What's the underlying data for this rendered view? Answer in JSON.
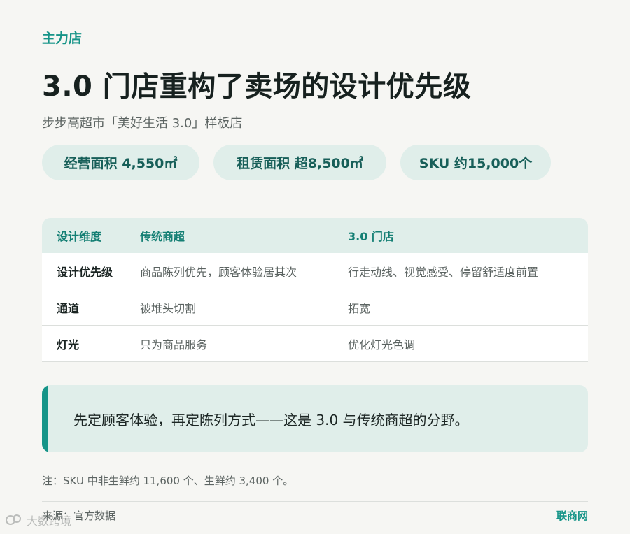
{
  "header": {
    "kicker": "主力店",
    "title": "3.0 门店重构了卖场的设计优先级",
    "subtitle": "步步高超市「美好生活 3.0」样板店"
  },
  "stats": [
    {
      "label": "经营面积 4,550㎡"
    },
    {
      "label": "租赁面积 超8,500㎡"
    },
    {
      "label": "SKU 约15,000个"
    }
  ],
  "table": {
    "headers": [
      "设计维度",
      "传统商超",
      "3.0 门店"
    ],
    "rows": [
      [
        "设计优先级",
        "商品陈列优先，顾客体验居其次",
        "行走动线、视觉感受、停留舒适度前置"
      ],
      [
        "通道",
        "被堆头切割",
        "拓宽"
      ],
      [
        "灯光",
        "只为商品服务",
        "优化灯光色调"
      ]
    ]
  },
  "callout": {
    "text": "先定顾客体验，再定陈列方式——这是 3.0 与传统商超的分野。"
  },
  "footer": {
    "note": "注：SKU 中非生鲜约 11,600 个、生鲜约 3,400 个。",
    "source": "来源：官方数据",
    "brand": "联商网"
  },
  "watermark": {
    "text": "大数跨境"
  },
  "colors": {
    "accent": "#169488",
    "accent_light": "#e0eeea",
    "background": "#f6f6f3"
  }
}
